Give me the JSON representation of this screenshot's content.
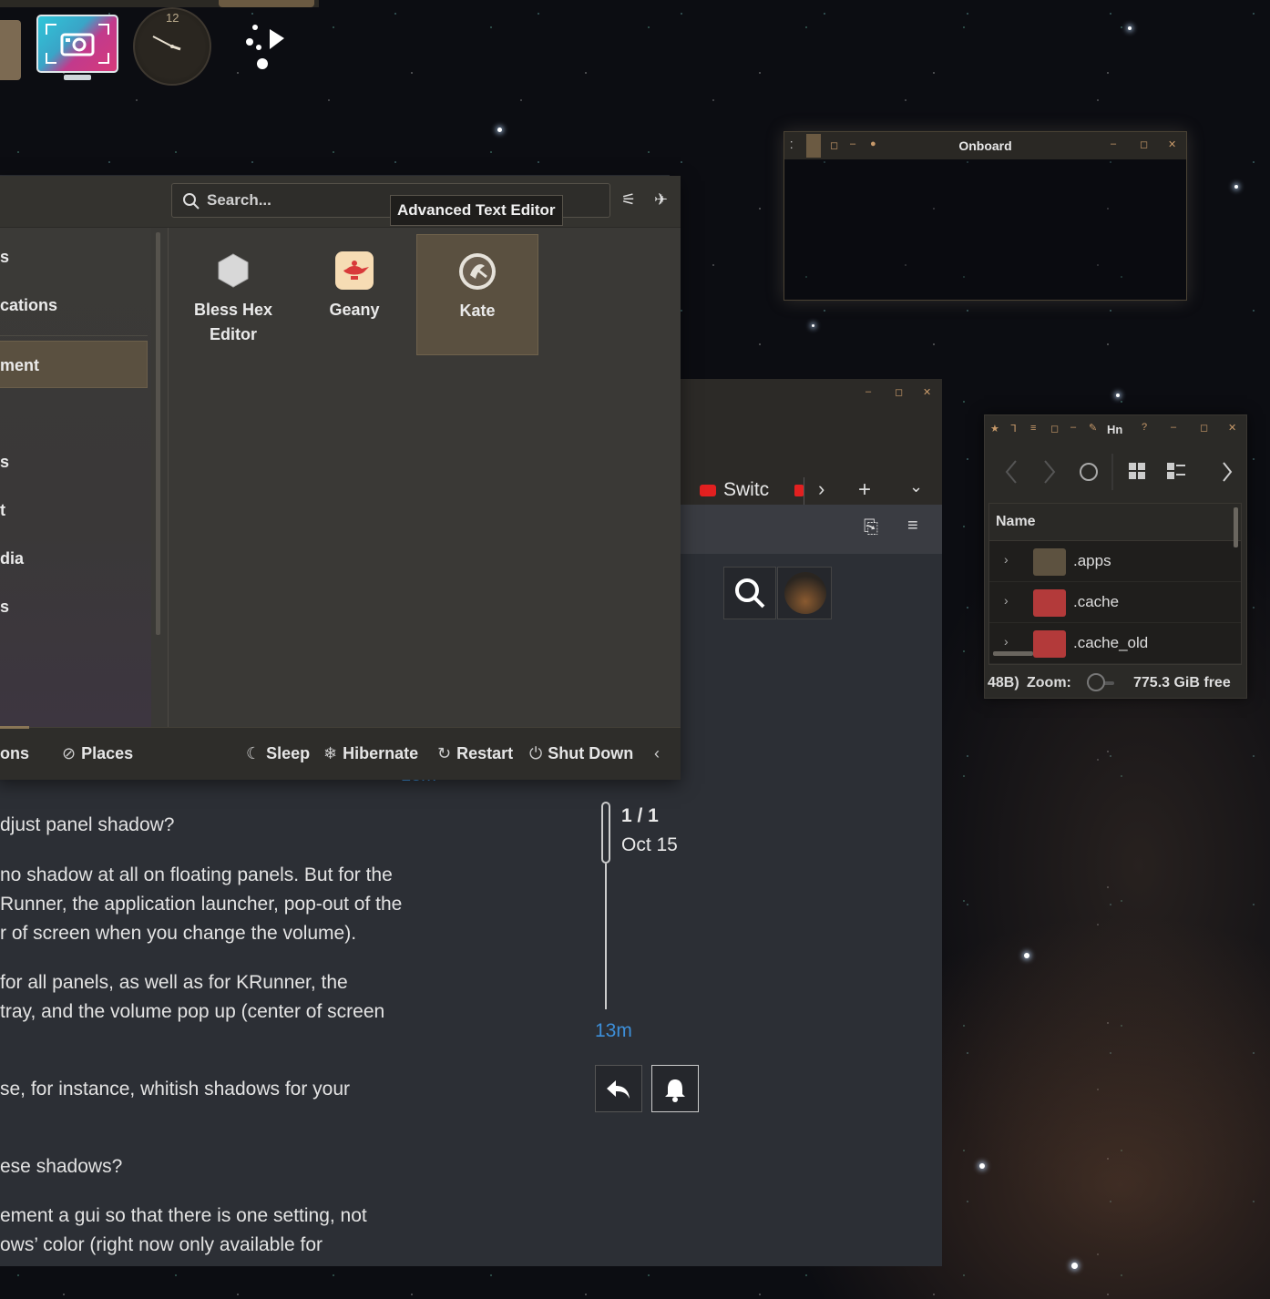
{
  "launcher": {
    "search_placeholder": "Search...",
    "tooltip": "Advanced Text Editor",
    "categories": [
      "s",
      "cations",
      "ment",
      "s",
      "t",
      "dia",
      "s"
    ],
    "apps": [
      {
        "label": "Bless Hex Editor",
        "icon": "hexagon-icon"
      },
      {
        "label": "Geany",
        "icon": "geany-lamp-icon"
      },
      {
        "label": "Kate",
        "icon": "kate-icon"
      }
    ],
    "footer": {
      "applications_tab": "ons",
      "places_tab": "Places",
      "sleep": "Sleep",
      "hibernate": "Hibernate",
      "restart": "Restart",
      "shutdown": "Shut Down"
    }
  },
  "clock": {
    "twelve": "12"
  },
  "onboard": {
    "title": "Onboard"
  },
  "file_manager": {
    "title": "Hn",
    "column_header": "Name",
    "rows": [
      ".apps",
      ".cache",
      ".cache_old"
    ],
    "status_left": "48B)",
    "zoom_label": "Zoom:",
    "free_space": "775.3 GiB free",
    "colors": {
      "accent": "#c89a6a"
    }
  },
  "browser": {
    "tab_label": "Switc",
    "thread": {
      "progress": "1 / 1",
      "date_top": "Oct 15",
      "date_bottom": "Oct 15",
      "last": "13m",
      "faded_left": "13m"
    },
    "colors": {
      "link": "#3d8fd9",
      "youtube": "#e22020"
    }
  },
  "forum": {
    "lines": [
      "djust panel shadow?",
      " no shadow at all on floating panels. But for the",
      "Runner, the application launcher, pop-out of the",
      "r of screen when you change the volume).",
      "for all panels, as well as for KRunner, the",
      " tray, and the volume pop up (center of screen",
      "se, for instance, whitish shadows for your",
      "ese shadows?",
      "ement a gui so that there is one setting, not",
      "ows’ color (right now only available for"
    ]
  }
}
